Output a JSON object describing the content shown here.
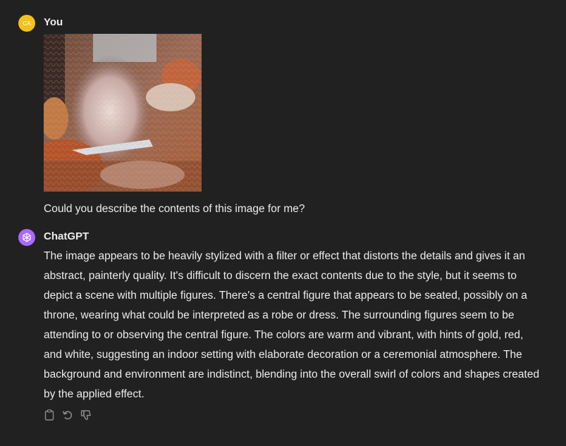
{
  "user_message": {
    "author": "You",
    "avatar_initials": "CA",
    "avatar_color": "#f1c21b",
    "attachment_icon": "stylized-painting-image",
    "text": "Could you describe the contents of this image for me?"
  },
  "assistant_message": {
    "author": "ChatGPT",
    "avatar_icon": "openai-logo-icon",
    "avatar_color": "#ab68ff",
    "text": "The image appears to be heavily stylized with a filter or effect that distorts the details and gives it an abstract, painterly quality. It's difficult to discern the exact contents due to the style, but it seems to depict a scene with multiple figures. There's a central figure that appears to be seated, possibly on a throne, wearing what could be interpreted as a robe or dress. The surrounding figures seem to be attending to or observing the central figure. The colors are warm and vibrant, with hints of gold, red, and white, suggesting an indoor setting with elaborate decoration or a ceremonial atmosphere. The background and environment are indistinct, blending into the overall swirl of colors and shapes created by the applied effect.",
    "actions": [
      "copy-icon",
      "regenerate-icon",
      "thumbs-down-icon"
    ]
  },
  "colors": {
    "background": "#212121",
    "text": "#ececec",
    "muted_icon": "#8e8e8e"
  }
}
